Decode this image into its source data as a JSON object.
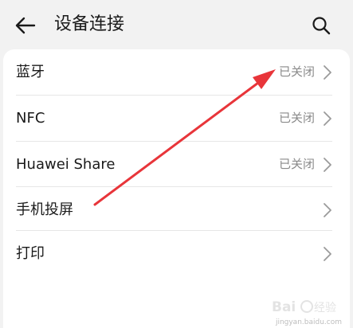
{
  "header": {
    "title": "设备连接",
    "back_icon": "back-arrow-icon",
    "search_icon": "search-icon"
  },
  "settings": [
    {
      "label": "蓝牙",
      "status": "已关闭"
    },
    {
      "label": "NFC",
      "status": "已关闭"
    },
    {
      "label": "Huawei Share",
      "status": "已关闭"
    },
    {
      "label": "手机投屏",
      "status": ""
    },
    {
      "label": "打印",
      "status": ""
    }
  ],
  "watermark": {
    "text": "jingyan.baidu.com"
  },
  "colors": {
    "background": "#f2f2f2",
    "card": "#ffffff",
    "annotation_arrow": "#e8353a",
    "status_text": "#8a8a8a"
  }
}
